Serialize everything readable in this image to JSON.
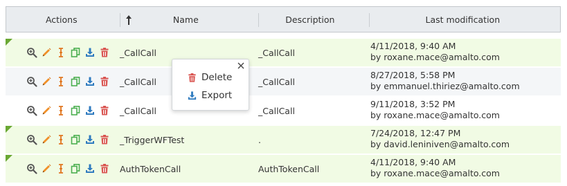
{
  "header": {
    "actions": "Actions",
    "name": "Name",
    "description": "Description",
    "last_modification": "Last modification"
  },
  "rows": [
    {
      "name": "_CallCall",
      "description": "_CallCall",
      "date": "4/11/2018, 9:40 AM",
      "by": "by roxane.mace@amalto.com",
      "highlight": "green"
    },
    {
      "name": "_CallCall",
      "description": "_CallCall",
      "date": "8/27/2018, 5:58 PM",
      "by": "by emmanuel.thiriez@amalto.com",
      "highlight": "gray"
    },
    {
      "name": "_CallCall",
      "description": "_CallCall",
      "date": "9/11/2018, 3:52 PM",
      "by": "by roxane.mace@amalto.com",
      "highlight": "white"
    },
    {
      "name": "_TriggerWFTest",
      "description": ".",
      "date": "7/24/2018, 12:47 PM",
      "by": "by david.leniniven@amalto.com",
      "highlight": "green"
    },
    {
      "name": "AuthTokenCall",
      "description": "AuthTokenCall",
      "date": "4/11/2018, 9:40 AM",
      "by": "by roxane.mace@amalto.com",
      "highlight": "green"
    }
  ],
  "row_action_icons": [
    "zoom-in-icon",
    "pencil-icon",
    "text-cursor-icon",
    "copy-icon",
    "download-icon",
    "trash-icon"
  ],
  "popup": {
    "delete_label": "Delete",
    "export_label": "Export"
  },
  "colors": {
    "green_row": "#f1fbe4",
    "gray_row": "#f4f6f8",
    "corner_marker": "#6aa833",
    "pencil": "#f0902a",
    "cursor": "#e0761f",
    "copy": "#4caf50",
    "download": "#2f7bbf",
    "trash": "#d9534f"
  }
}
